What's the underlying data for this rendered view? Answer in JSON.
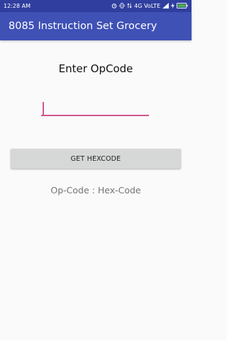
{
  "status_bar": {
    "time": "12:28 AM",
    "indicators": {
      "alarm": "⏰",
      "vibrate": "📳",
      "data_arrows": "⇅",
      "network": "4G VoLTE",
      "signal": "📶",
      "charging": "⚡",
      "battery": "🔋"
    }
  },
  "app_bar": {
    "title": "8085 Instruction Set Grocery",
    "color": "#3f51b5"
  },
  "main": {
    "prompt": "Enter OpCode",
    "input": {
      "value": "",
      "placeholder": "",
      "accent_color": "#d0568e"
    },
    "button_label": "GET HEXCODE",
    "result_text": "Op-Code : Hex-Code"
  }
}
